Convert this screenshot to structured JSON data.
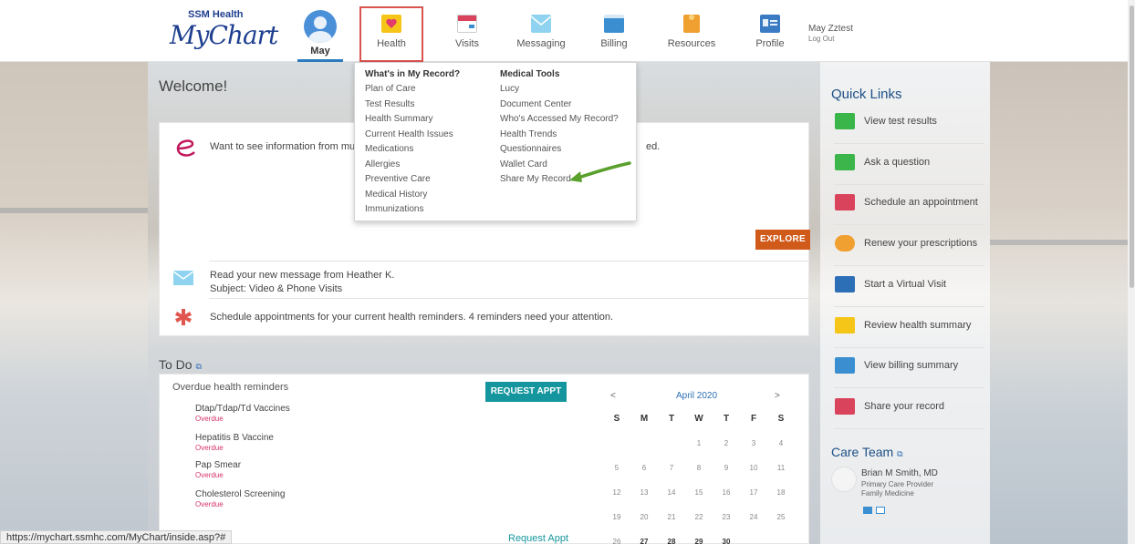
{
  "brand": {
    "sub": "SSM Health",
    "main": "MyChart"
  },
  "user": {
    "avatar_name": "May",
    "display_name": "May Zztest",
    "logout": "Log Out"
  },
  "nav": [
    {
      "label": "Health",
      "icon": "heart-icon",
      "color": "#f5c518"
    },
    {
      "label": "Visits",
      "icon": "calendar-icon",
      "color": "#d9435b"
    },
    {
      "label": "Messaging",
      "icon": "envelope-icon",
      "color": "#8fd3f0"
    },
    {
      "label": "Billing",
      "icon": "credit-card-icon",
      "color": "#3b8fd1"
    },
    {
      "label": "Resources",
      "icon": "book-icon",
      "color": "#f0a030"
    },
    {
      "label": "Profile",
      "icon": "id-card-icon",
      "color": "#3b7bc4"
    }
  ],
  "health_menu": {
    "col1_title": "What's in My Record?",
    "col1": [
      "Plan of Care",
      "Test Results",
      "Health Summary",
      "Current Health Issues",
      "Medications",
      "Allergies",
      "Preventive Care",
      "Medical History",
      "Immunizations"
    ],
    "col2_title": "Medical Tools",
    "col2": [
      "Lucy",
      "Document Center",
      "Who's Accessed My Record?",
      "Health Trends",
      "Questionnaires",
      "Wallet Card",
      "Share My Record"
    ]
  },
  "welcome": "Welcome!",
  "promo": {
    "text": "Want to see information from mult",
    "tail": "ed.",
    "button": "EXPLORE"
  },
  "messages": [
    {
      "line1": "Read your new message from Heather K.",
      "line2": "Subject: Video & Phone Visits"
    },
    {
      "line1": "Schedule appointments for your current health reminders. 4 reminders need your attention."
    }
  ],
  "todo": {
    "title": "To Do",
    "subtitle": "Overdue health reminders",
    "button": "REQUEST APPT",
    "link": "Request Appt",
    "reminders": [
      {
        "name": "Dtap/Tdap/Td Vaccines",
        "status": "Overdue"
      },
      {
        "name": "Hepatitis B Vaccine",
        "status": "Overdue"
      },
      {
        "name": "Pap Smear",
        "status": "Overdue"
      },
      {
        "name": "Cholesterol Screening",
        "status": "Overdue"
      }
    ]
  },
  "calendar": {
    "prev": "<",
    "month": "April 2020",
    "next": ">",
    "dow": [
      "S",
      "M",
      "T",
      "W",
      "T",
      "F",
      "S"
    ],
    "days": [
      "",
      "",
      "",
      "1",
      "2",
      "3",
      "4",
      "5",
      "6",
      "7",
      "8",
      "9",
      "10",
      "11",
      "12",
      "13",
      "14",
      "15",
      "16",
      "17",
      "18",
      "19",
      "20",
      "21",
      "22",
      "23",
      "24",
      "25",
      "26",
      "27",
      "28",
      "29",
      "30",
      "",
      ""
    ],
    "bold_days": [
      "27",
      "28",
      "29",
      "30"
    ]
  },
  "quick_links": {
    "title": "Quick Links",
    "items": [
      {
        "label": "View test results",
        "icon": "test-tubes-icon"
      },
      {
        "label": "Ask a question",
        "icon": "chat-bubbles-icon"
      },
      {
        "label": "Schedule an appointment",
        "icon": "calendar-icon"
      },
      {
        "label": "Renew your prescriptions",
        "icon": "pill-icon"
      },
      {
        "label": "Start a Virtual Visit",
        "icon": "stethoscope-icon"
      },
      {
        "label": "Review health summary",
        "icon": "heart-folder-icon"
      },
      {
        "label": "View billing summary",
        "icon": "credit-card-icon"
      },
      {
        "label": "Share your record",
        "icon": "share-heart-icon"
      }
    ]
  },
  "care_team": {
    "title": "Care Team",
    "name": "Brian M Smith, MD",
    "role1": "Primary Care Provider",
    "role2": "Family Medicine"
  },
  "status_bar": "https://mychart.ssmhc.com/MyChart/inside.asp?#"
}
